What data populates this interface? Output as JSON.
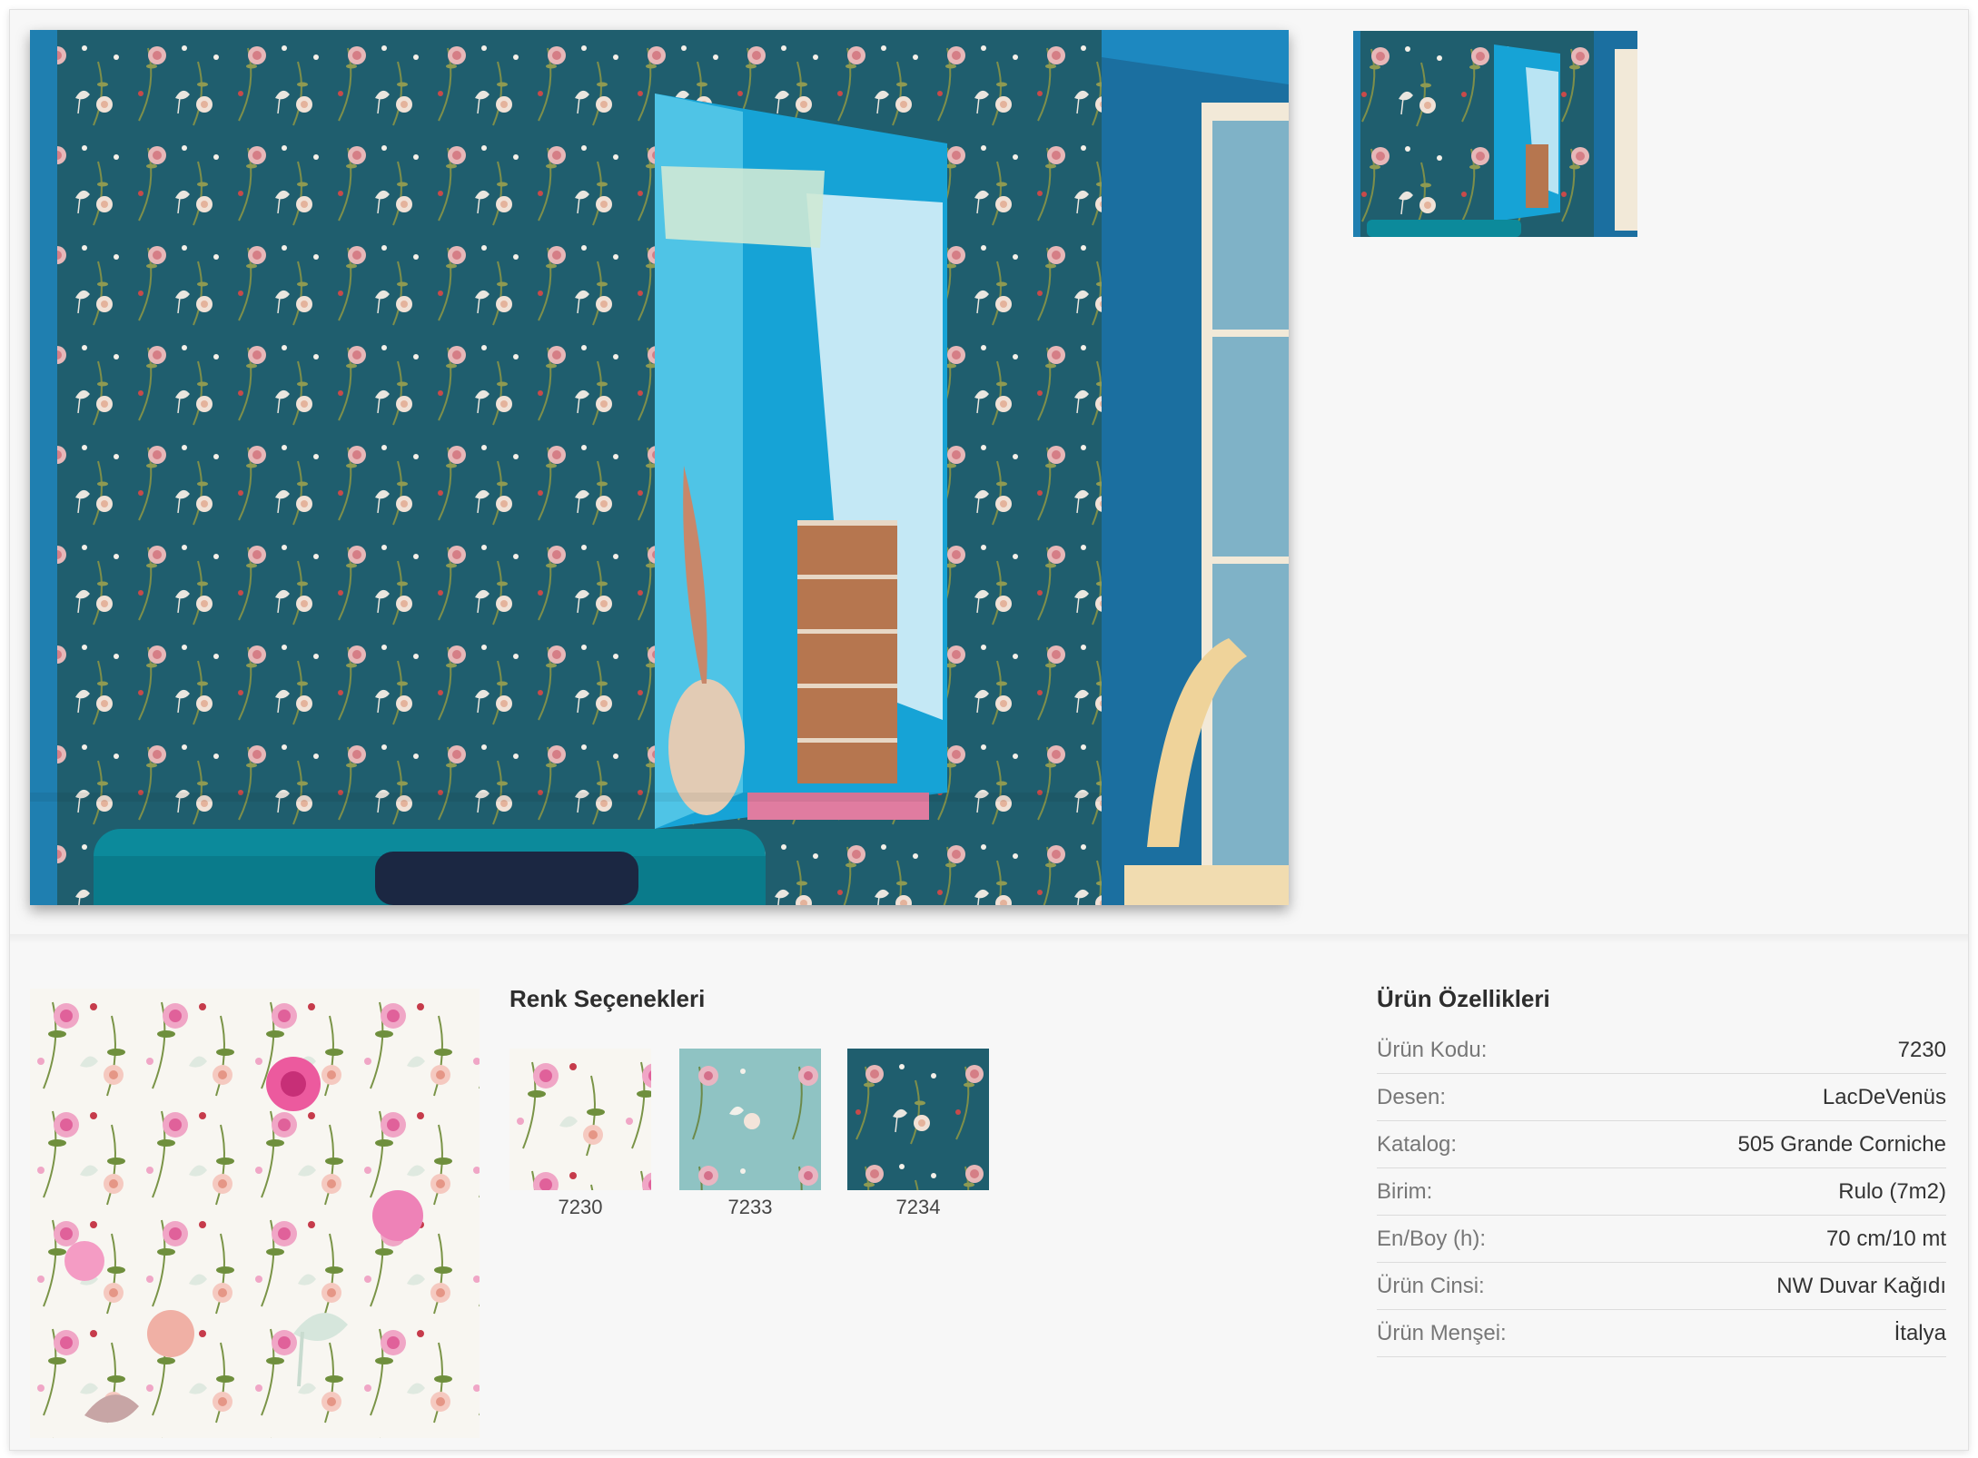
{
  "gallery": {
    "main_image_icon": "wallpaper-room-photo",
    "thumbnail_icon": "wallpaper-room-thumbnail"
  },
  "pattern_preview_icon": "floral-pattern-swatch",
  "color_options": {
    "title": "Renk Seçenekleri",
    "items": [
      {
        "code": "7230",
        "color": "#f4f2ee"
      },
      {
        "code": "7233",
        "color": "#8fc3c3"
      },
      {
        "code": "7234",
        "color": "#1d5a6b"
      }
    ]
  },
  "properties": {
    "title": "Ürün Özellikleri",
    "rows": [
      {
        "label": "Ürün Kodu:",
        "value": "7230"
      },
      {
        "label": "Desen:",
        "value": "LacDeVenüs"
      },
      {
        "label": "Katalog:",
        "value": "505 Grande Corniche"
      },
      {
        "label": "Birim:",
        "value": "Rulo (7m2)"
      },
      {
        "label": "En/Boy (h):",
        "value": "70 cm/10 mt"
      },
      {
        "label": "Ürün Cinsi:",
        "value": "NW Duvar Kağıdı"
      },
      {
        "label": "Ürün Menşei:",
        "value": "İtalya"
      }
    ]
  },
  "colors": {
    "page_bg": "#f7f7f7",
    "wall_teal": "#1d5a6b",
    "alcove_blue": "#1aa3d1"
  }
}
